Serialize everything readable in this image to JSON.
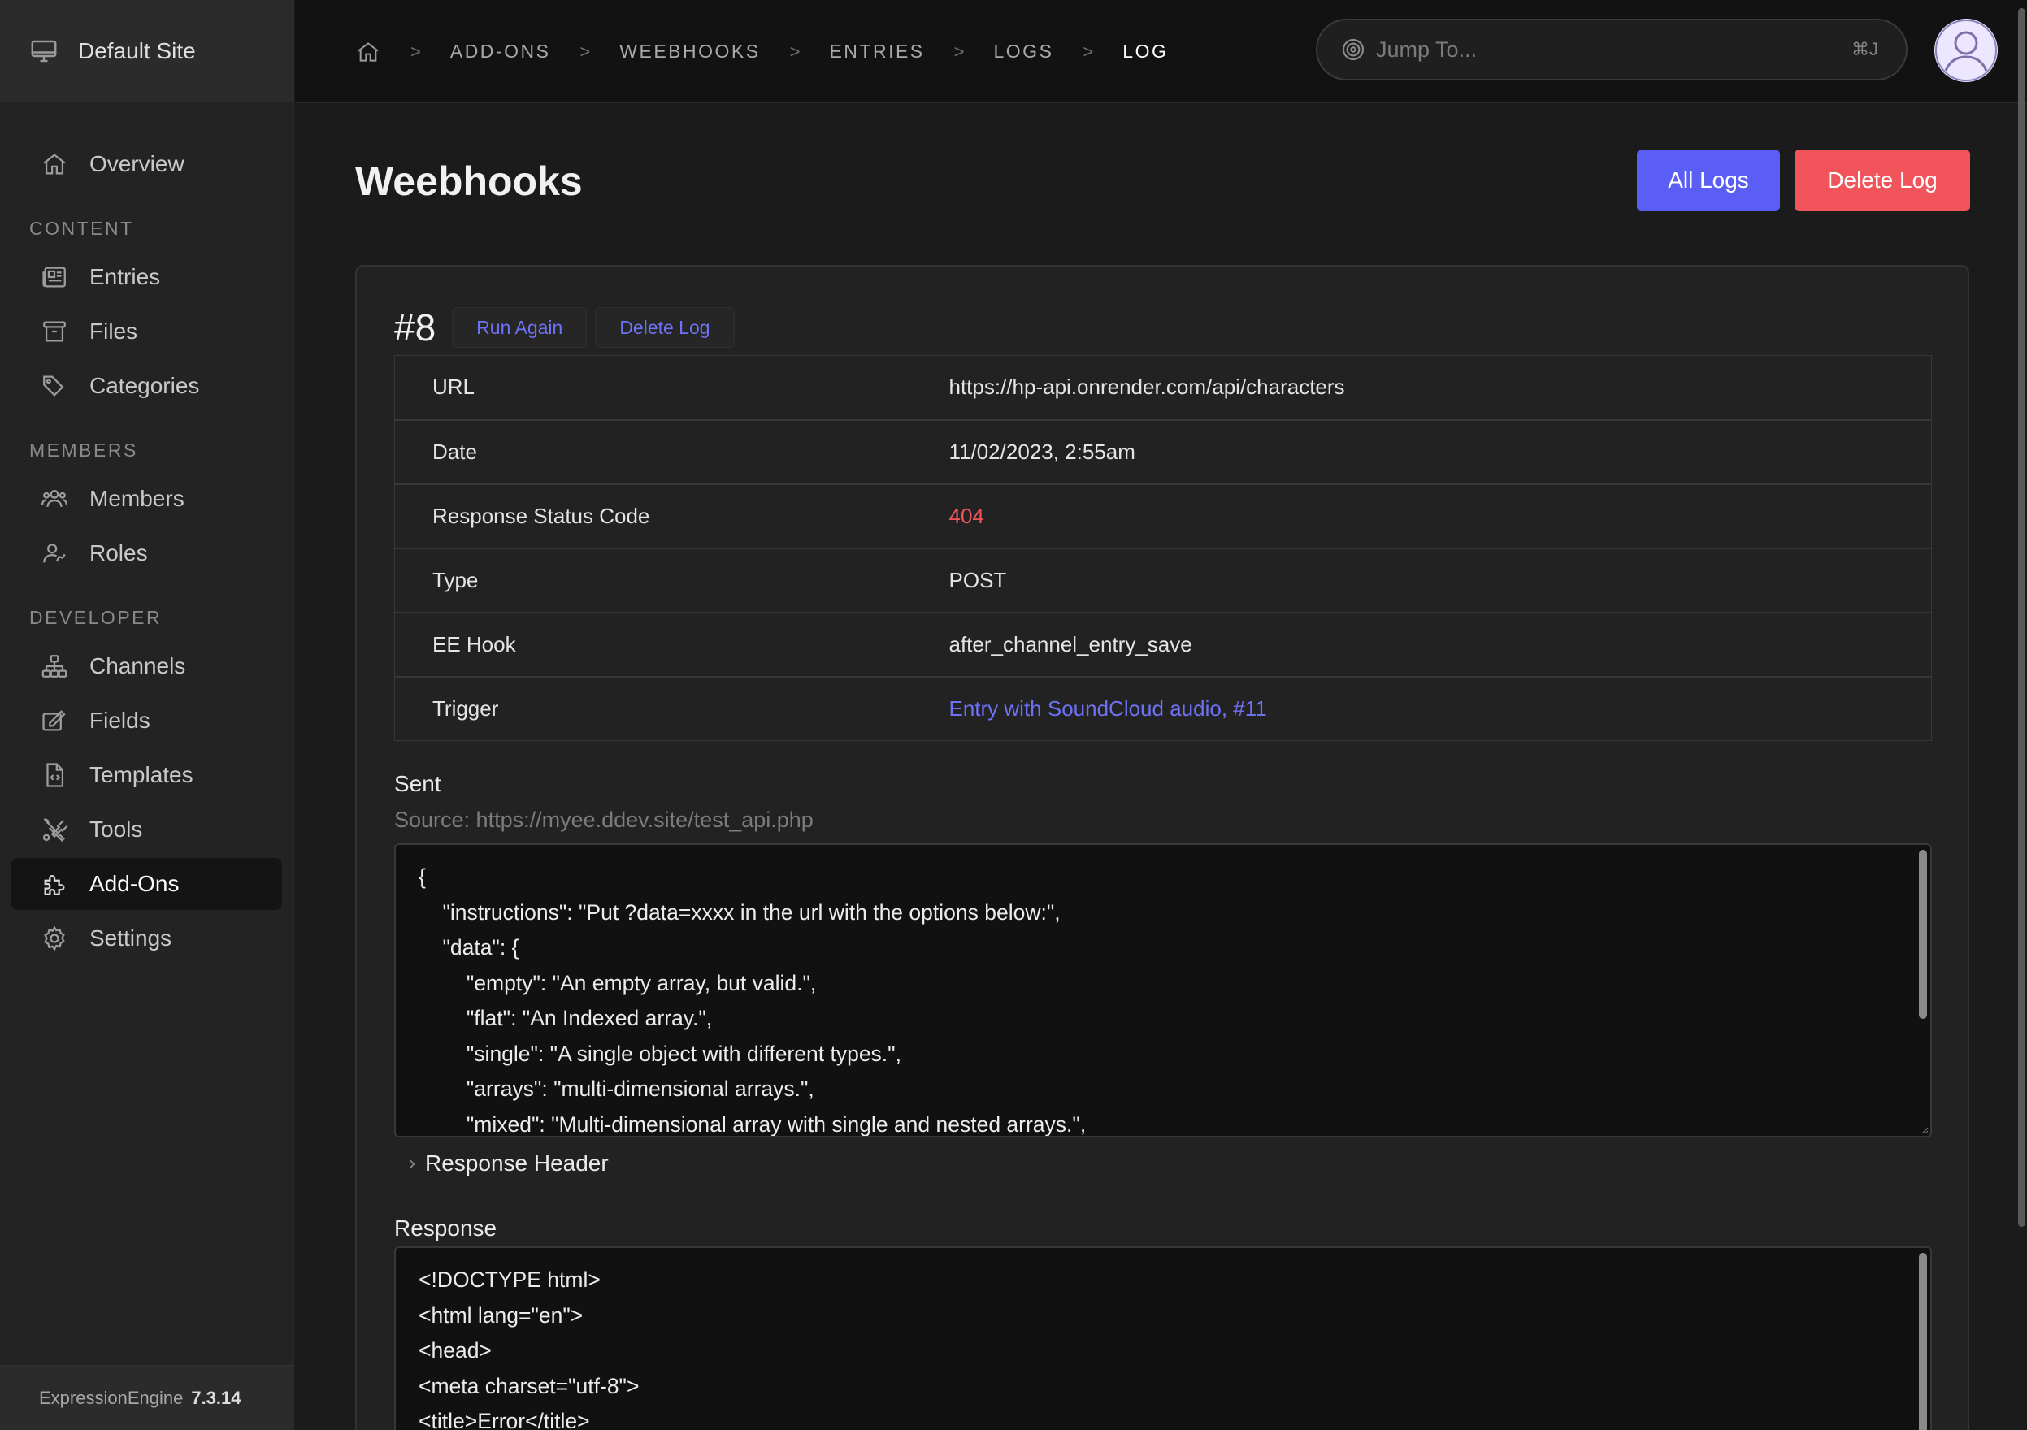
{
  "site": {
    "name": "Default Site",
    "icon": "monitor-icon"
  },
  "sidebar": {
    "top_items": [
      {
        "label": "Overview",
        "icon": "home-icon"
      }
    ],
    "sections": [
      {
        "label": "CONTENT",
        "items": [
          {
            "label": "Entries",
            "icon": "entries-icon"
          },
          {
            "label": "Files",
            "icon": "archive-icon"
          },
          {
            "label": "Categories",
            "icon": "tags-icon"
          }
        ]
      },
      {
        "label": "MEMBERS",
        "items": [
          {
            "label": "Members",
            "icon": "users-icon"
          },
          {
            "label": "Roles",
            "icon": "user-role-icon"
          }
        ]
      },
      {
        "label": "DEVELOPER",
        "items": [
          {
            "label": "Channels",
            "icon": "sitemap-icon"
          },
          {
            "label": "Fields",
            "icon": "edit-icon"
          },
          {
            "label": "Templates",
            "icon": "file-code-icon"
          },
          {
            "label": "Tools",
            "icon": "tools-icon"
          },
          {
            "label": "Add-Ons",
            "icon": "puzzle-icon",
            "active": true
          },
          {
            "label": "Settings",
            "icon": "gear-icon"
          }
        ]
      }
    ],
    "footer": {
      "product": "ExpressionEngine",
      "version": "7.3.14"
    }
  },
  "breadcrumb": [
    "ADD-ONS",
    "WEEBHOOKS",
    "ENTRIES",
    "LOGS",
    "LOG"
  ],
  "search": {
    "placeholder": "Jump To...",
    "shortcut": "⌘J"
  },
  "page": {
    "title": "Weebhooks",
    "all_logs_label": "All Logs",
    "delete_log_label": "Delete Log"
  },
  "log": {
    "number": "#8",
    "run_again_label": "Run Again",
    "delete_label": "Delete Log",
    "rows": [
      {
        "key": "URL",
        "value": "https://hp-api.onrender.com/api/characters"
      },
      {
        "key": "Date",
        "value": "11/02/2023, 2:55am"
      },
      {
        "key": "Response Status Code",
        "value": "404"
      },
      {
        "key": "Type",
        "value": "POST"
      },
      {
        "key": "EE Hook",
        "value": "after_channel_entry_save"
      },
      {
        "key": "Trigger",
        "value": "Entry with SoundCloud audio, #11"
      }
    ],
    "sent_title": "Sent",
    "sent_source": "Source: https://myee.ddev.site/test_api.php",
    "sent_body": "{\n    \"instructions\": \"Put ?data=xxxx in the url with the options below:\",\n    \"data\": {\n        \"empty\": \"An empty array, but valid.\",\n        \"flat\": \"An Indexed array.\",\n        \"single\": \"A single object with different types.\",\n        \"arrays\": \"multi-dimensional arrays.\",\n        \"mixed\": \"Multi-dimensional array with single and nested arrays.\",",
    "response_header_label": "Response Header",
    "response_title": "Response",
    "response_body": "<!DOCTYPE html>\n<html lang=\"en\">\n<head>\n<meta charset=\"utf-8\">\n<title>Error</title>"
  },
  "colors": {
    "accent": "#5b5ef4",
    "danger": "#f2545b",
    "link": "#6e72f5"
  }
}
